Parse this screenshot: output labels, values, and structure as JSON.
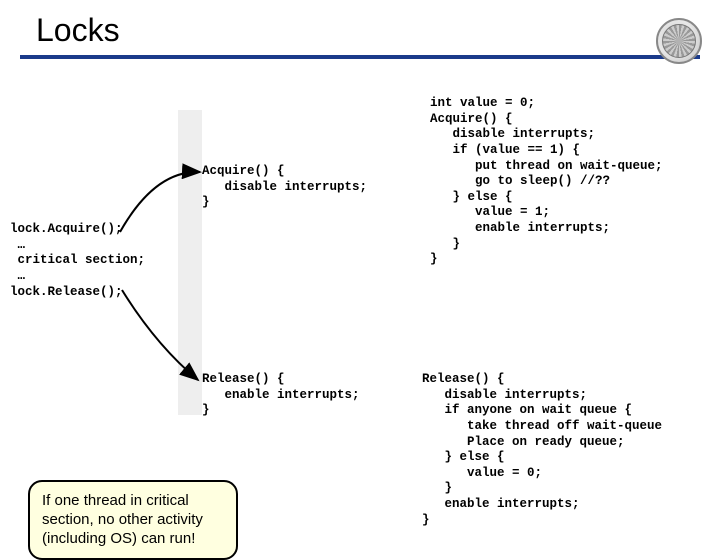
{
  "title": "Locks",
  "code": {
    "usage": "lock.Acquire();\n …\n critical section;\n …\nlock.Release();",
    "acquire_simple": "Acquire() {\n   disable interrupts;\n}",
    "release_simple": "Release() {\n   enable interrupts;\n}",
    "acquire_full": "int value = 0;\nAcquire() {\n   disable interrupts;\n   if (value == 1) {\n      put thread on wait-queue;\n      go to sleep() //??\n   } else {\n      value = 1;\n      enable interrupts;\n   }\n}",
    "release_full": "Release() {\n   disable interrupts;\n   if anyone on wait queue {\n      take thread off wait-queue\n      Place on ready queue;\n   } else {\n      value = 0;\n   }\n   enable interrupts;\n}"
  },
  "callout": "If one thread in critical section, no other activity (including OS) can run!"
}
